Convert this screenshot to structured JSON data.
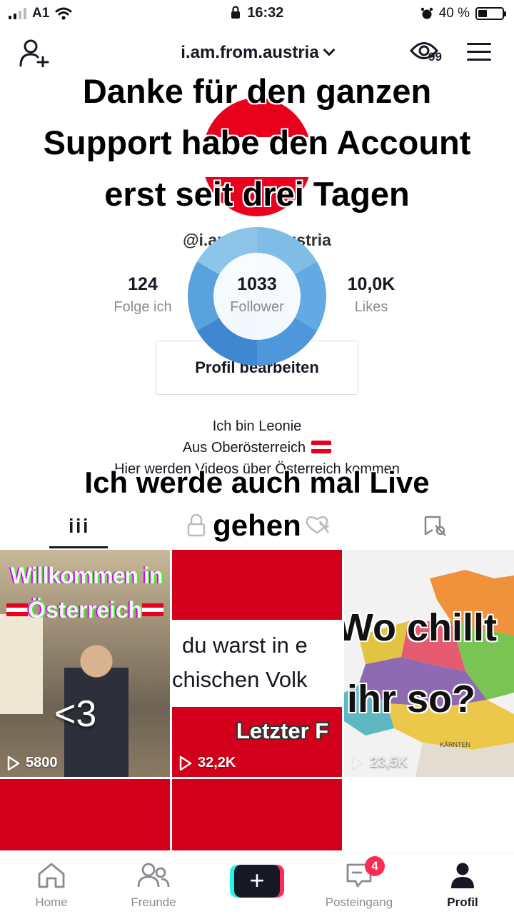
{
  "status_bar": {
    "carrier": "A1",
    "time": "16:32",
    "battery": "40 %",
    "icons": [
      "signal-icon",
      "wifi-icon",
      "lock-icon",
      "alarm-icon",
      "battery-icon"
    ]
  },
  "header": {
    "username": "i.am.from.austria",
    "views_badge": "99",
    "icons": [
      "add-user-icon",
      "chevron-down-icon",
      "eye-icon",
      "menu-icon"
    ]
  },
  "overlay": {
    "title_lines": [
      "Danke für den ganzen",
      "Support habe den Account",
      "erst seit drei Tagen"
    ],
    "live_lines": [
      "Ich werde auch mal Live",
      "gehen"
    ]
  },
  "profile": {
    "handle": "@i.am.from.austria",
    "stats": [
      {
        "value": "124",
        "label": "Folge ich"
      },
      {
        "value": "1033",
        "label": "Follower"
      },
      {
        "value": "10,0K",
        "label": "Likes"
      }
    ],
    "edit_button": "Profil bearbeiten",
    "bio": [
      "Ich bin Leonie",
      "Aus Oberösterreich",
      "Hier werden Videos über Österreich kommen"
    ]
  },
  "tabs": {
    "items": [
      "videos-grid-tab",
      "private-tab",
      "liked-tab",
      "favorites-tab"
    ],
    "active": 0
  },
  "videos": [
    {
      "text_lines": [
        "Willkommen in",
        "Österreich"
      ],
      "sticker": "<3",
      "views": "5800",
      "color": "#9c8d74"
    },
    {
      "text_lines": [
        "du warst in e",
        "chischen Volk",
        "Letzter F"
      ],
      "views": "32,2K",
      "color": "#d2001a"
    },
    {
      "text_lines": [
        "Wo chillt",
        "ihr so?",
        "KÄRNTEN"
      ],
      "views": "23,5K",
      "color": "#f2f2f2"
    },
    {
      "text_lines": [],
      "views": "",
      "color": "#d2001a"
    },
    {
      "text_lines": [],
      "views": "",
      "color": "#d2001a"
    }
  ],
  "bottom_nav": {
    "items": [
      {
        "label": "Home",
        "icon": "home-icon"
      },
      {
        "label": "Freunde",
        "icon": "friends-icon"
      },
      {
        "label": "",
        "icon": "plus-icon"
      },
      {
        "label": "Posteingang",
        "icon": "inbox-icon",
        "badge": "4"
      },
      {
        "label": "Profil",
        "icon": "profile-icon"
      }
    ],
    "active": "Profil"
  },
  "colors": {
    "text": "#161823",
    "muted": "#8a8b91",
    "accent_red": "#fe2c55",
    "accent_cyan": "#25f4ee",
    "austria_red": "#e8001c",
    "loader_blue": "#4f97db"
  }
}
